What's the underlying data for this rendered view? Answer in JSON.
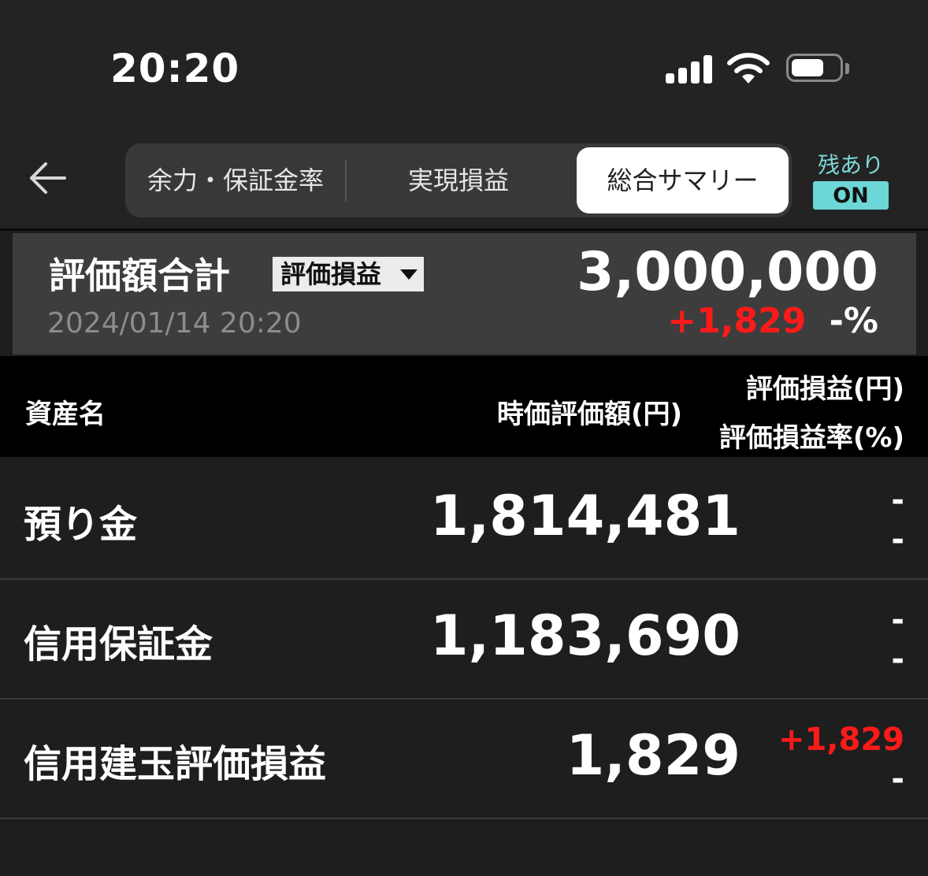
{
  "status_bar": {
    "time": "20:20"
  },
  "nav": {
    "tabs": [
      {
        "label": "余力・保証金率"
      },
      {
        "label": "実現損益"
      },
      {
        "label": "総合サマリー",
        "selected": true
      }
    ],
    "zan_label": "残あり",
    "zan_toggle": "ON"
  },
  "summary": {
    "title": "評価額合計",
    "mode_select": "評価損益",
    "datetime": "2024/01/14 20:20",
    "total": "3,000,000",
    "change": "+1,829",
    "rate": "-%"
  },
  "table": {
    "headers": {
      "name": "資産名",
      "value": "時価評価額(円)",
      "pl": "評価損益(円)",
      "rate": "評価損益率(%)"
    },
    "rows": [
      {
        "name": "預り金",
        "value": "1,814,481",
        "pl": "-",
        "rate": "-"
      },
      {
        "name": "信用保証金",
        "value": "1,183,690",
        "pl": "-",
        "rate": "-"
      },
      {
        "name": "信用建玉評価損益",
        "value": "1,829",
        "pl": "+1,829",
        "rate": "-"
      }
    ]
  },
  "colors": {
    "positive": "#ff1a1a",
    "accent": "#6dd6d6"
  }
}
